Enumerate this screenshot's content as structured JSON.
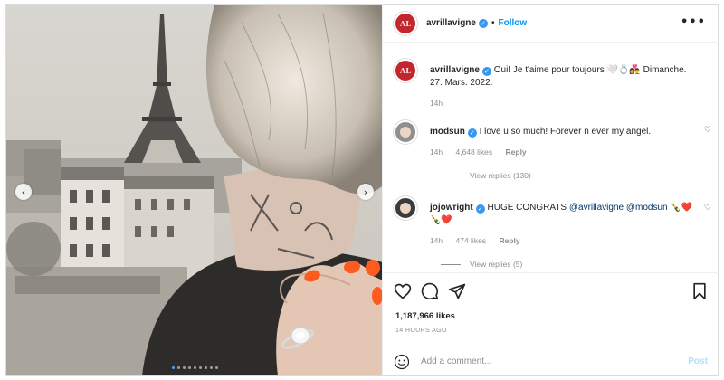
{
  "header": {
    "username": "avrillavigne",
    "separator": "•",
    "follow_label": "Follow",
    "more_icon": "more-horizontal-icon",
    "more_glyph": "•••"
  },
  "caption": {
    "username": "avrillavigne",
    "text": "Oui! Je t'aime pour toujours 🤍💍👩‍❤️‍👨 Dimanche. 27. Mars. 2022.",
    "time": "14h"
  },
  "comments": [
    {
      "username": "modsun",
      "text": "I love u so much! Forever n ever my angel.",
      "time": "14h",
      "likes": "4,648 likes",
      "reply_label": "Reply",
      "view_replies": "View replies (130)"
    },
    {
      "username": "jojowright",
      "text_prefix": "HUGE CONGRATS ",
      "mention1": "@avrillavigne",
      "mention2": "@modsun",
      "text_suffix": " 🍾❤️🍾❤️",
      "time": "14h",
      "likes": "474 likes",
      "reply_label": "Reply",
      "view_replies": "View replies (5)"
    }
  ],
  "stats": {
    "likes": "1,187,966 likes",
    "time_ago": "14 HOURS AGO"
  },
  "add_comment": {
    "placeholder": "Add a comment...",
    "post_label": "Post"
  },
  "carousel": {
    "prev_glyph": "‹",
    "next_glyph": "›",
    "dots_total": 9,
    "dots_active_index": 0
  },
  "icons": {
    "avatar_monogram": "AL",
    "verified_glyph": "✓",
    "comment_like_glyph": "♡"
  },
  "colors": {
    "accent": "#0095f6",
    "verified": "#3897f0",
    "brand_avatar": "#c2272d",
    "post_disabled": "#b2dffc"
  }
}
